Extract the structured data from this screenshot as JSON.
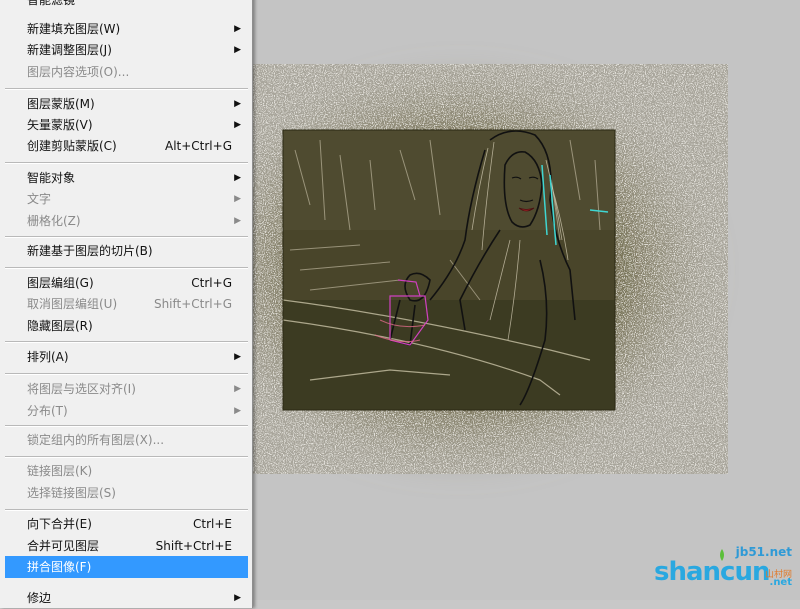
{
  "menu": {
    "items": [
      {
        "label": "智能滤镜",
        "shortcut": "",
        "submenu": false,
        "disabled": false
      },
      {
        "label": "新建填充图层(W)",
        "shortcut": "",
        "submenu": true,
        "disabled": false
      },
      {
        "label": "新建调整图层(J)",
        "shortcut": "",
        "submenu": true,
        "disabled": false
      },
      {
        "label": "图层内容选项(O)...",
        "shortcut": "",
        "submenu": false,
        "disabled": true
      },
      {
        "label": "图层蒙版(M)",
        "shortcut": "",
        "submenu": true,
        "disabled": false
      },
      {
        "label": "矢量蒙版(V)",
        "shortcut": "",
        "submenu": true,
        "disabled": false
      },
      {
        "label": "创建剪贴蒙版(C)",
        "shortcut": "Alt+Ctrl+G",
        "submenu": false,
        "disabled": false
      },
      {
        "label": "智能对象",
        "shortcut": "",
        "submenu": true,
        "disabled": false
      },
      {
        "label": "文字",
        "shortcut": "",
        "submenu": true,
        "disabled": true
      },
      {
        "label": "栅格化(Z)",
        "shortcut": "",
        "submenu": true,
        "disabled": true
      },
      {
        "label": "新建基于图层的切片(B)",
        "shortcut": "",
        "submenu": false,
        "disabled": false
      },
      {
        "label": "图层编组(G)",
        "shortcut": "Ctrl+G",
        "submenu": false,
        "disabled": false
      },
      {
        "label": "取消图层编组(U)",
        "shortcut": "Shift+Ctrl+G",
        "submenu": false,
        "disabled": true
      },
      {
        "label": "隐藏图层(R)",
        "shortcut": "",
        "submenu": false,
        "disabled": false
      },
      {
        "label": "排列(A)",
        "shortcut": "",
        "submenu": true,
        "disabled": false
      },
      {
        "label": "将图层与选区对齐(I)",
        "shortcut": "",
        "submenu": true,
        "disabled": true
      },
      {
        "label": "分布(T)",
        "shortcut": "",
        "submenu": true,
        "disabled": true
      },
      {
        "label": "锁定组内的所有图层(X)...",
        "shortcut": "",
        "submenu": false,
        "disabled": true
      },
      {
        "label": "链接图层(K)",
        "shortcut": "",
        "submenu": false,
        "disabled": true
      },
      {
        "label": "选择链接图层(S)",
        "shortcut": "",
        "submenu": false,
        "disabled": true
      },
      {
        "label": "向下合并(E)",
        "shortcut": "Ctrl+E",
        "submenu": false,
        "disabled": false
      },
      {
        "label": "合并可见图层",
        "shortcut": "Shift+Ctrl+E",
        "submenu": false,
        "disabled": false
      },
      {
        "label": "拼合图像(F)",
        "shortcut": "",
        "submenu": false,
        "disabled": false,
        "selected": true
      },
      {
        "label": "修边",
        "shortcut": "",
        "submenu": true,
        "disabled": false
      }
    ],
    "submenu_arrow": "▶",
    "selected_color": "#3399ff"
  },
  "watermark": {
    "site": "jb51.net",
    "brand": "shancun",
    "sub": "山村网",
    "net": ".net"
  }
}
